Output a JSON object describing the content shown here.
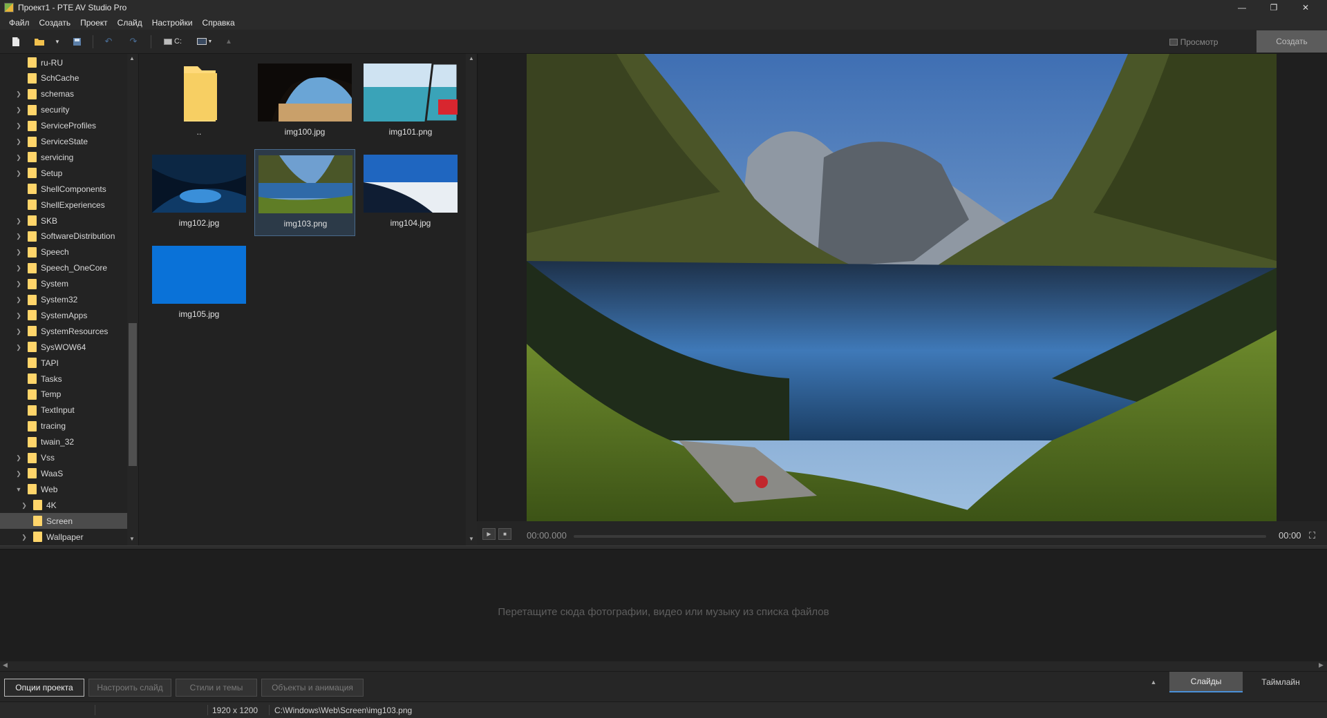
{
  "app": {
    "title": "Проект1 - PTE AV Studio Pro",
    "window_controls": [
      "minimize",
      "restore",
      "close"
    ]
  },
  "menu": [
    "Файл",
    "Создать",
    "Проект",
    "Слайд",
    "Настройки",
    "Справка"
  ],
  "toolbar": {
    "drive_label": "C:",
    "preview_label": "Просмотр",
    "create_label": "Создать"
  },
  "tree": {
    "items": [
      {
        "label": "ru-RU",
        "expandable": false,
        "level": 0
      },
      {
        "label": "SchCache",
        "expandable": false,
        "level": 0
      },
      {
        "label": "schemas",
        "expandable": true,
        "level": 0
      },
      {
        "label": "security",
        "expandable": true,
        "level": 0
      },
      {
        "label": "ServiceProfiles",
        "expandable": true,
        "level": 0
      },
      {
        "label": "ServiceState",
        "expandable": true,
        "level": 0
      },
      {
        "label": "servicing",
        "expandable": true,
        "level": 0
      },
      {
        "label": "Setup",
        "expandable": true,
        "level": 0
      },
      {
        "label": "ShellComponents",
        "expandable": false,
        "level": 0
      },
      {
        "label": "ShellExperiences",
        "expandable": false,
        "level": 0
      },
      {
        "label": "SKB",
        "expandable": true,
        "level": 0
      },
      {
        "label": "SoftwareDistribution",
        "expandable": true,
        "level": 0
      },
      {
        "label": "Speech",
        "expandable": true,
        "level": 0
      },
      {
        "label": "Speech_OneCore",
        "expandable": true,
        "level": 0
      },
      {
        "label": "System",
        "expandable": true,
        "level": 0
      },
      {
        "label": "System32",
        "expandable": true,
        "level": 0
      },
      {
        "label": "SystemApps",
        "expandable": true,
        "level": 0
      },
      {
        "label": "SystemResources",
        "expandable": true,
        "level": 0
      },
      {
        "label": "SysWOW64",
        "expandable": true,
        "level": 0
      },
      {
        "label": "TAPI",
        "expandable": false,
        "level": 0
      },
      {
        "label": "Tasks",
        "expandable": false,
        "level": 0
      },
      {
        "label": "Temp",
        "expandable": false,
        "level": 0
      },
      {
        "label": "TextInput",
        "expandable": false,
        "level": 0
      },
      {
        "label": "tracing",
        "expandable": false,
        "level": 0
      },
      {
        "label": "twain_32",
        "expandable": false,
        "level": 0
      },
      {
        "label": "Vss",
        "expandable": true,
        "level": 0
      },
      {
        "label": "WaaS",
        "expandable": true,
        "level": 0
      },
      {
        "label": "Web",
        "expandable": true,
        "expanded": true,
        "level": 0
      },
      {
        "label": "4K",
        "expandable": true,
        "level": 1
      },
      {
        "label": "Screen",
        "expandable": false,
        "level": 1,
        "selected": true
      },
      {
        "label": "Wallpaper",
        "expandable": true,
        "level": 1
      }
    ]
  },
  "files": [
    {
      "name": "..",
      "kind": "folder"
    },
    {
      "name": "img100.jpg",
      "kind": "cave"
    },
    {
      "name": "img101.png",
      "kind": "sea"
    },
    {
      "name": "img102.jpg",
      "kind": "ice"
    },
    {
      "name": "img103.png",
      "kind": "lake",
      "selected": true
    },
    {
      "name": "img104.jpg",
      "kind": "hill"
    },
    {
      "name": "img105.jpg",
      "kind": "blue"
    }
  ],
  "player": {
    "current_time": "00:00.000",
    "end_time": "00:00",
    "progress": 0
  },
  "timeline": {
    "hint": "Перетащите сюда фотографии, видео или музыку из списка файлов"
  },
  "bottom": {
    "buttons": [
      "Опции проекта",
      "Настроить слайд",
      "Стили и темы",
      "Объекты и анимация"
    ],
    "tabs": [
      "Слайды",
      "Таймлайн"
    ]
  },
  "status": {
    "resolution": "1920 x 1200",
    "path": "C:\\Windows\\Web\\Screen\\img103.png"
  }
}
